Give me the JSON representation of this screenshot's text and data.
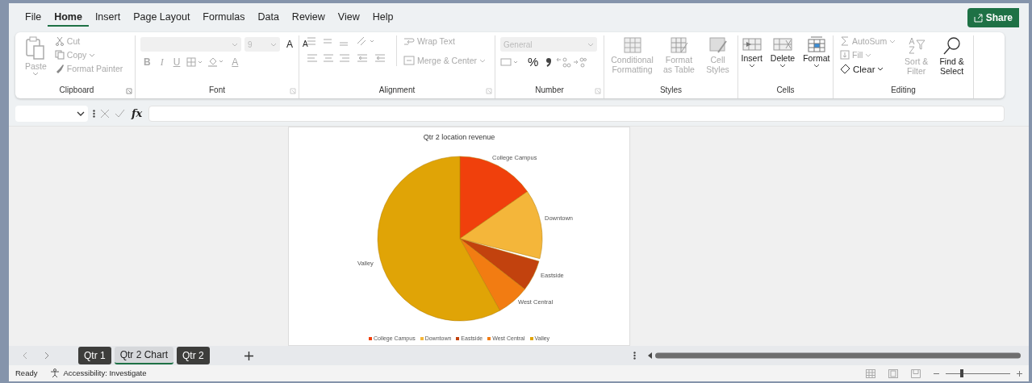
{
  "menu_tabs": [
    {
      "label": "File",
      "selected": false
    },
    {
      "label": "Home",
      "selected": true
    },
    {
      "label": "Insert",
      "selected": false
    },
    {
      "label": "Page Layout",
      "selected": false
    },
    {
      "label": "Formulas",
      "selected": false
    },
    {
      "label": "Data",
      "selected": false
    },
    {
      "label": "Review",
      "selected": false
    },
    {
      "label": "View",
      "selected": false
    },
    {
      "label": "Help",
      "selected": false
    }
  ],
  "share_button": "Share",
  "ribbon": [
    {
      "label": "Clipboard",
      "items": [
        {
          "label": "Paste",
          "disabled": true
        },
        {
          "label": "Cut",
          "disabled": true
        },
        {
          "label": "Copy",
          "disabled": true
        },
        {
          "label": "Format Painter",
          "disabled": true
        }
      ]
    },
    {
      "label": "Font",
      "items": [
        {
          "value": "9",
          "disabled": true
        },
        {
          "label": "A",
          "disabled": false
        },
        {
          "label": "A",
          "disabled": false
        },
        {
          "label": "B",
          "disabled": true
        },
        {
          "label": "I",
          "disabled": true
        },
        {
          "label": "U",
          "disabled": true
        },
        {
          "label": "A",
          "disabled": true
        }
      ]
    },
    {
      "label": "Alignment",
      "items": [
        {
          "label": "Wrap Text",
          "disabled": true
        },
        {
          "label": "Merge & Center",
          "disabled": true
        }
      ]
    },
    {
      "label": "Number",
      "items": [
        {
          "value": "General",
          "disabled": true
        },
        {
          "label": "%",
          "disabled": false
        }
      ]
    },
    {
      "label": "Styles",
      "items": [
        {
          "label": "Conditional Formatting",
          "disabled": true
        },
        {
          "label": "Format as Table",
          "disabled": true
        },
        {
          "label": "Cell Styles",
          "disabled": true
        }
      ]
    },
    {
      "label": "Cells",
      "items": [
        {
          "label": "Insert",
          "disabled": false
        },
        {
          "label": "Delete",
          "disabled": false
        },
        {
          "label": "Format",
          "disabled": false
        }
      ]
    },
    {
      "label": "Editing",
      "items": [
        {
          "label": "AutoSum",
          "disabled": true
        },
        {
          "label": "Fill",
          "disabled": true
        },
        {
          "label": "Clear",
          "disabled": false
        },
        {
          "label": "Sort & Filter",
          "disabled": true
        },
        {
          "label": "Find & Select",
          "disabled": false
        }
      ]
    }
  ],
  "formula_bar": {
    "function_label": "fx"
  },
  "chart": {
    "title": "Qtr 2 location revenue",
    "slices": [
      {
        "label": "College Campus",
        "color": "#f0400c"
      },
      {
        "label": "Downtown",
        "color": "#f4b63a"
      },
      {
        "label": "Eastside",
        "color": "#c2420e"
      },
      {
        "label": "West Central",
        "color": "#f27c12"
      },
      {
        "label": "Valley",
        "color": "#e0a406"
      }
    ],
    "legend": [
      {
        "label": "College Campus",
        "color": "#f0400c"
      },
      {
        "label": "Downtown",
        "color": "#f4b63a"
      },
      {
        "label": "Eastside",
        "color": "#c2420e"
      },
      {
        "label": "West Central",
        "color": "#f27c12"
      },
      {
        "label": "Valley",
        "color": "#e0a406"
      }
    ]
  },
  "sheet_tabs": [
    {
      "label": "Qtr 1",
      "selected": false,
      "color": "#3d3d3b"
    },
    {
      "label": "Qtr 2 Chart",
      "selected": true
    },
    {
      "label": "Qtr 2",
      "selected": false,
      "color": "#3d3d3b"
    }
  ],
  "status_bar": {
    "ready": "Ready",
    "accessibility": "Accessibility: Investigate"
  },
  "zoom": {
    "level": 0.25
  }
}
